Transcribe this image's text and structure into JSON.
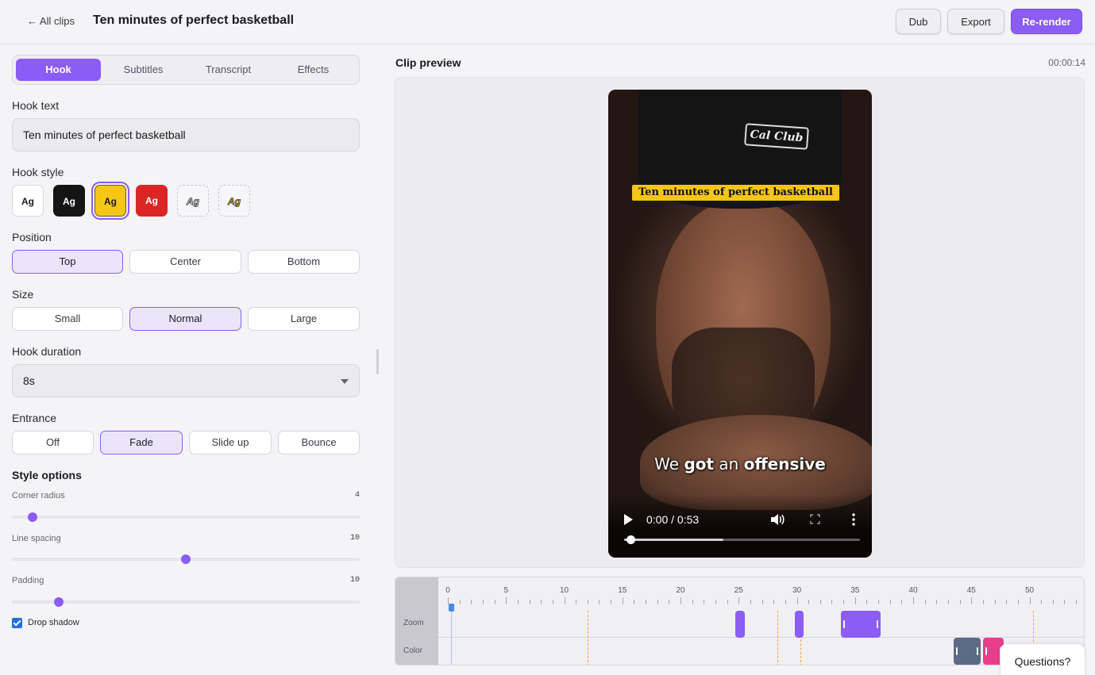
{
  "header": {
    "back_label": "← All clips",
    "title": "Ten minutes of perfect basketball",
    "dub_label": "Dub",
    "export_label": "Export",
    "rerender_label": "Re-render"
  },
  "tabs": [
    "Hook",
    "Subtitles",
    "Transcript",
    "Effects"
  ],
  "active_tab": "Hook",
  "hook_text": {
    "label": "Hook text",
    "value": "Ten minutes of perfect basketball"
  },
  "hook_style": {
    "label": "Hook style",
    "swatch_text": "Ag",
    "selected_index": 2,
    "colors": [
      "#ffffff",
      "#151515",
      "#f5c518",
      "#dc2626",
      "outline-white",
      "outline-yellow"
    ]
  },
  "position": {
    "label": "Position",
    "options": [
      "Top",
      "Center",
      "Bottom"
    ],
    "selected": "Top"
  },
  "size": {
    "label": "Size",
    "options": [
      "Small",
      "Normal",
      "Large"
    ],
    "selected": "Normal"
  },
  "hook_duration": {
    "label": "Hook duration",
    "value": "8s"
  },
  "entrance": {
    "label": "Entrance",
    "options": [
      "Off",
      "Fade",
      "Slide up",
      "Bounce"
    ],
    "selected": "Fade"
  },
  "style_options": {
    "title": "Style options",
    "sliders": [
      {
        "label": "Corner radius",
        "value": "4",
        "fraction": 0.06
      },
      {
        "label": "Line spacing",
        "value": "10",
        "fraction": 0.5
      },
      {
        "label": "Padding",
        "value": "10",
        "fraction": 0.135
      }
    ],
    "drop_shadow": {
      "label": "Drop shadow",
      "checked": true
    }
  },
  "preview": {
    "title": "Clip preview",
    "timecode": "00:00:14",
    "hook_caption": "Ten minutes of perfect basketball",
    "cap_logo": "Cal Club",
    "subtitle_words": [
      {
        "text": "We",
        "bold": false
      },
      {
        "text": "got",
        "bold": true
      },
      {
        "text": "an",
        "bold": false
      },
      {
        "text": "offensive",
        "bold": true
      }
    ],
    "player_time": "0:00 / 0:53",
    "played_fraction": 0.0,
    "buffered_fraction": 0.42
  },
  "timeline": {
    "ticks": [
      "0",
      "5",
      "10",
      "15",
      "20",
      "25",
      "30",
      "35",
      "40",
      "45",
      "50",
      "5"
    ],
    "tracks": [
      "Zoom",
      "Color"
    ],
    "playhead_seconds": 0.3,
    "markers_seconds": [
      12,
      28.3,
      30.3,
      50.3
    ],
    "zoom_clips": [
      {
        "start": 24.7,
        "end": 25.5,
        "handles": false
      },
      {
        "start": 29.8,
        "end": 30.6,
        "handles": false
      },
      {
        "start": 33.8,
        "end": 37.2,
        "handles": true
      }
    ],
    "color_clips": [
      {
        "start": 43.5,
        "end": 45.8,
        "color": "#5c6a85",
        "handles": true
      },
      {
        "start": 46.0,
        "end": 47.8,
        "color": "#e83e8c",
        "handles": true
      }
    ]
  },
  "help": {
    "label": "Questions?"
  }
}
